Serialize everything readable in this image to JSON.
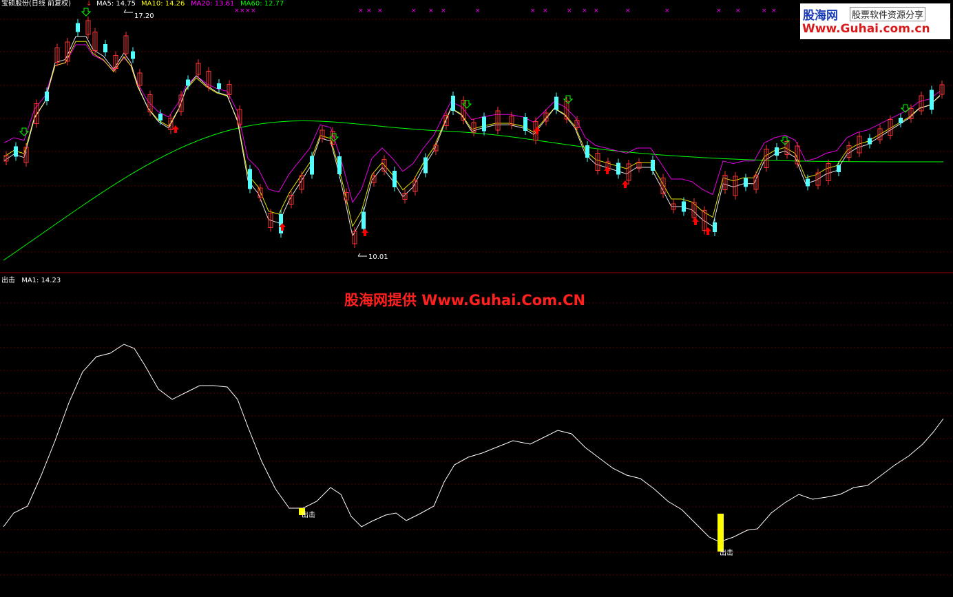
{
  "header": {
    "stock_title": "宝硕股份(日线 前复权)",
    "ma5": {
      "label": "MA5: 14.75",
      "color": "#ffffff"
    },
    "ma10": {
      "label": "MA10: 14.26",
      "color": "#ffff00"
    },
    "ma20": {
      "label": "MA20: 13.61",
      "color": "#ff00ff"
    },
    "ma60": {
      "label": "MA60: 12.77",
      "color": "#00ff00"
    },
    "x_markers_label": "××××"
  },
  "price_panel": {
    "high_label": "17.20",
    "low_label": "10.01",
    "up_color": "#ff3232",
    "down_color": "#54ffff",
    "buy_arrow_color": "#ff0000",
    "sell_arrow_color": "#00ff00",
    "x_marker_color": "#ff00ff"
  },
  "indicator_panel": {
    "title": "出击",
    "ma_label": "MA1: 14.23",
    "signal_label": "出击",
    "signal_color": "#ffff00",
    "line_color": "#ffffff"
  },
  "watermark": {
    "logo_brand": "股海网",
    "logo_slogan": "股票软件资源分享",
    "logo_url": "Www.Guhai.com.cn",
    "center_text": "股海网提供 Www.Guhai.Com.CN"
  },
  "grid_color": "#5a0000",
  "divider_color": "#a00000"
}
